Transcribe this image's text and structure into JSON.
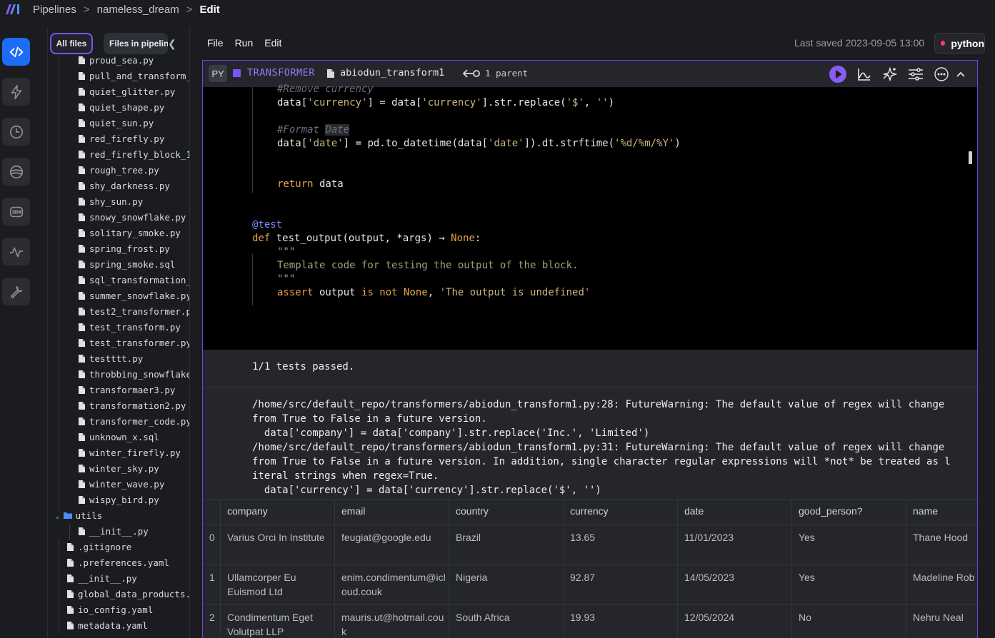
{
  "breadcrumb": {
    "items": [
      "Pipelines",
      "nameless_dream",
      "Edit"
    ],
    "separator": ">"
  },
  "rail": {
    "icons": [
      "code-icon",
      "bolt-icon",
      "clock-icon",
      "globe-icon",
      "archive-icon",
      "activity-icon",
      "wrench-icon"
    ],
    "active": "code-icon"
  },
  "file_panel": {
    "tabs": {
      "all_files": "All files",
      "files_in_pipeline": "Files in pipeline"
    },
    "files": [
      "proud_sea.py",
      "pull_and_transform_",
      "quiet_glitter.py",
      "quiet_shape.py",
      "quiet_sun.py",
      "red_firefly.py",
      "red_firefly_block_1",
      "rough_tree.py",
      "shy_darkness.py",
      "shy_sun.py",
      "snowy_snowflake.py",
      "solitary_smoke.py",
      "spring_frost.py",
      "spring_smoke.sql",
      "sql_transformation_",
      "summer_snowflake.py",
      "test2_transformer.p",
      "test_transform.py",
      "test_transformer.py",
      "testttt.py",
      "throbbing_snowflake",
      "transformaer3.py",
      "transformation2.py",
      "transformer_code.py",
      "unknown_x.sql",
      "winter_firefly.py",
      "winter_sky.py",
      "winter_wave.py",
      "wispy_bird.py"
    ],
    "utils_folder": "utils",
    "utils_files": [
      "__init__.py"
    ],
    "root_files": [
      ".gitignore",
      ".preferences.yaml",
      "__init__.py",
      "global_data_products.y",
      "io_config.yaml",
      "metadata.yaml"
    ]
  },
  "menu": {
    "file": "File",
    "run": "Run",
    "edit": "Edit"
  },
  "status": {
    "last_saved": "Last saved 2023-09-05 13:00",
    "kernel": "python",
    "kernel_color": "#ff3d5a"
  },
  "block": {
    "lang_tag": "PY",
    "type": "TRANSFORMER",
    "type_color": "#7b55f3",
    "name": "abiodun_transform1",
    "parents": "1 parent"
  },
  "code": {
    "remove_comment": "#Remove currency",
    "line_currency": [
      "data[",
      "'currency'",
      "] = data[",
      "'currency'",
      "].str.replace(",
      "'$'",
      ", ",
      "''",
      ")"
    ],
    "format_comment_a": "#Format ",
    "format_comment_b": "Date",
    "line_date": [
      "data[",
      "'date'",
      "] = pd.to_datetime(data[",
      "'date'",
      "]).dt.strftime(",
      "'%d/%m/%Y'",
      ")"
    ],
    "return_kw": "return",
    "return_val": " data",
    "decorator": "@test",
    "def_kw": "def",
    "def_sig": " test_output(output, *args) → ",
    "def_ret": "None",
    "def_colon": ":",
    "docq": "\"\"\"",
    "doc_text": "Template code for testing the output of the block.",
    "assert_kw": "assert",
    "assert_mid": " output ",
    "is_kw": "is not",
    "none_kw": "None",
    "assert_comma": ", ",
    "assert_msg": "'The output is undefined'"
  },
  "output": {
    "tests_result": "1/1 tests passed.",
    "warnings": [
      "/home/src/default_repo/transformers/abiodun_transform1.py:28: FutureWarning: The default value of regex will change",
      "from True to False in a future version.",
      "  data['company'] = data['company'].str.replace('Inc.', 'Limited')",
      "/home/src/default_repo/transformers/abiodun_transform1.py:31: FutureWarning: The default value of regex will change",
      "from True to False in a future version. In addition, single character regular expressions will *not* be treated as l",
      "iteral strings when regex=True.",
      "  data['currency'] = data['currency'].str.replace('$', '')"
    ]
  },
  "table": {
    "columns": [
      "company",
      "email",
      "country",
      "currency",
      "date",
      "good_person?",
      "name"
    ],
    "rows": [
      {
        "index": "0",
        "cells": [
          "Varius Orci In Institute",
          "feugiat@google.edu",
          "Brazil",
          "13.65",
          "11/01/2023",
          "Yes",
          "Thane Hood"
        ]
      },
      {
        "index": "1",
        "cells": [
          "Ullamcorper Eu Euismod Ltd",
          "enim.condimentum@icloud.couk",
          "Nigeria",
          "92.87",
          "14/05/2023",
          "Yes",
          "Madeline Rob"
        ]
      },
      {
        "index": "2",
        "cells": [
          "Condimentum Eget Volutpat LLP",
          "mauris.ut@hotmail.couk",
          "South Africa",
          "19.93",
          "12/05/2024",
          "No",
          "Nehru Neal"
        ]
      }
    ]
  }
}
